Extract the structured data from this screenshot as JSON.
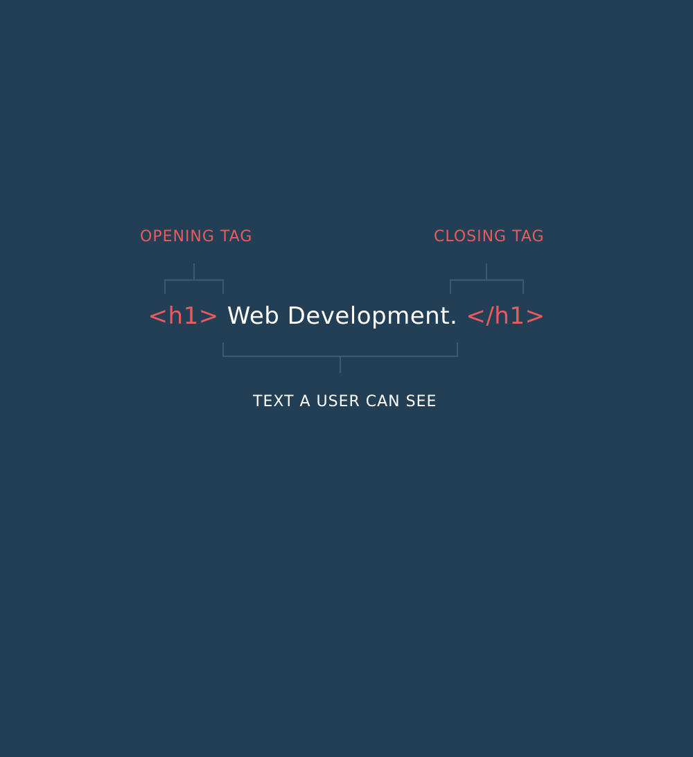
{
  "labels": {
    "opening": "OPENING TAG",
    "closing": "CLOSING TAG",
    "content": "TEXT A USER CAN SEE"
  },
  "code": {
    "open_tag": "<h1>",
    "content": "Web Development.",
    "close_tag": "</h1>"
  },
  "colors": {
    "background": "#223f55",
    "accent": "#ea5b5f",
    "text": "#ffffff",
    "bracket": "#3d5a6e"
  }
}
